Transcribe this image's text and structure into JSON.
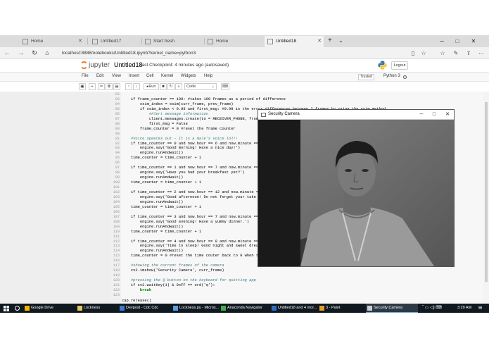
{
  "browser": {
    "tabs": [
      {
        "label": "Home",
        "active": false
      },
      {
        "label": "Untitled17",
        "active": false
      },
      {
        "label": "Start fresh",
        "active": false
      },
      {
        "label": "Home",
        "active": false
      },
      {
        "label": "Untitled18",
        "active": true
      }
    ],
    "url": "localhost:8888/notebooks/Untitled18.ipynb?kernel_name=python3"
  },
  "jupyter": {
    "brand": "jupyter",
    "notebook_title": "Untitled18",
    "checkpoint": "Last Checkpoint: 4 minutes ago  (autosaved)",
    "logout_label": "Logout",
    "menu": [
      "File",
      "Edit",
      "View",
      "Insert",
      "Cell",
      "Kernel",
      "Widgets",
      "Help"
    ],
    "trusted_label": "Trusted",
    "kernel_label": "Python 3",
    "run_label": "Run",
    "cell_type": "Code"
  },
  "code": {
    "lines": [
      {
        "n": "82",
        "t": "",
        "k": "c"
      },
      {
        "n": "83",
        "t": "    if frame_counter == 100: #takes 100 frames as a period of difference",
        "k": "c"
      },
      {
        "n": "84",
        "t": "        ssim_index = ssim(curr_frame, prev_frame)",
        "k": "c"
      },
      {
        "n": "85",
        "t": "        if ssim_index < 0.98 and first_msg: #0.98 is the error differences between 2 frames by using the ssim method",
        "k": "c"
      },
      {
        "n": "86",
        "t": "            #Alert message information",
        "k": "cm"
      },
      {
        "n": "87",
        "t": "            client.messages.create(to = RECEIVER_PHONE, from_=",
        "k": "c"
      },
      {
        "n": "88",
        "t": "            first_msg = False",
        "k": "c"
      },
      {
        "n": "89",
        "t": "        frame_counter = 0 #reset the frame counter",
        "k": "c"
      },
      {
        "n": "90",
        "t": "",
        "k": "c"
      },
      {
        "n": "91",
        "t": "    #Voice speecks out - It is a male's voice lol!!",
        "k": "cm"
      },
      {
        "n": "92",
        "t": "    if time_counter == 0 and now.hour == 6 and now.minute ==",
        "k": "c"
      },
      {
        "n": "93",
        "t": "        engine.say('Good morning! Have a nice day!')",
        "k": "c"
      },
      {
        "n": "94",
        "t": "        engine.runAndwait()",
        "k": "c"
      },
      {
        "n": "95",
        "t": "    time_counter = time_counter + 1",
        "k": "c"
      },
      {
        "n": "96",
        "t": "",
        "k": "c"
      },
      {
        "n": "97",
        "t": "    if time_counter == 1 and now.hour == 7 and now.minute ==",
        "k": "c"
      },
      {
        "n": "98",
        "t": "        engine.say('Have you had your breakfast yet?')",
        "k": "c"
      },
      {
        "n": "99",
        "t": "        engine.runAndwait()",
        "k": "c"
      },
      {
        "n": "100",
        "t": "    time_counter = time_counter + 1",
        "k": "c"
      },
      {
        "n": "101",
        "t": "",
        "k": "c"
      },
      {
        "n": "102",
        "t": "    if time_counter == 2 and now.hour == 12 and now.minute ==",
        "k": "c"
      },
      {
        "n": "103",
        "t": "        engine.say('Good afternoon! Do not forget your take y",
        "k": "c"
      },
      {
        "n": "104",
        "t": "        engine.runAndwait()",
        "k": "c"
      },
      {
        "n": "105",
        "t": "    time_counter = time_counter + 1",
        "k": "c"
      },
      {
        "n": "106",
        "t": "",
        "k": "c"
      },
      {
        "n": "107",
        "t": "    if time_counter == 3 and now.hour == 7 and now.minute ==",
        "k": "c"
      },
      {
        "n": "108",
        "t": "        engine.say('Good evening! Have a yummy dinner.')",
        "k": "c"
      },
      {
        "n": "109",
        "t": "        engine.runAndwait()",
        "k": "c"
      },
      {
        "n": "110",
        "t": "    time_counter = time_counter + 1",
        "k": "c"
      },
      {
        "n": "111",
        "t": "",
        "k": "c"
      },
      {
        "n": "112",
        "t": "    if time_counter == 4 and now.hour == 9 and now.minute ==",
        "k": "c"
      },
      {
        "n": "113",
        "t": "        engine.say('Time to sleep! Good night and sweet dream",
        "k": "c"
      },
      {
        "n": "114",
        "t": "        engine.runAndwait()",
        "k": "c"
      },
      {
        "n": "115",
        "t": "    time_counter = 0 #reset the time couter back to 0 when t",
        "k": "c"
      },
      {
        "n": "116",
        "t": "",
        "k": "c"
      },
      {
        "n": "117",
        "t": "    #showing the current frames of the camera",
        "k": "cm"
      },
      {
        "n": "118",
        "t": "    cv2.imshow('Security Camera', curr_frame)",
        "k": "c"
      },
      {
        "n": "119",
        "t": "",
        "k": "c"
      },
      {
        "n": "120",
        "t": "    #pressing the Q button on the keyboard for quitting app",
        "k": "cm"
      },
      {
        "n": "121",
        "t": "    if cv2.waitKey(1) & 0xFF == ord('q'):",
        "k": "c"
      },
      {
        "n": "122",
        "t": "        break",
        "k": "kw"
      },
      {
        "n": "123",
        "t": "",
        "k": "c"
      }
    ],
    "last_line": "cap.release()"
  },
  "camera_window": {
    "title": "Security Camera"
  },
  "taskbar": {
    "items": [
      {
        "label": "Google Drive",
        "color": "#f4b400"
      },
      {
        "label": "Lockness",
        "color": "#e8c45a"
      },
      {
        "label": "Devpost - Cdc Cdc",
        "color": "#3b7bd1"
      },
      {
        "label": "Lockness.py - Micros...",
        "color": "#5aa0e6"
      },
      {
        "label": "Anaconda Navigator",
        "color": "#43b049"
      },
      {
        "label": "Untitled18 and 4 mor...",
        "color": "#2b6cc4"
      },
      {
        "label": "3 - Paint",
        "color": "#e0a030"
      },
      {
        "label": "Security Camera",
        "color": "#cccccc"
      }
    ],
    "clock": "3:29 AM"
  }
}
